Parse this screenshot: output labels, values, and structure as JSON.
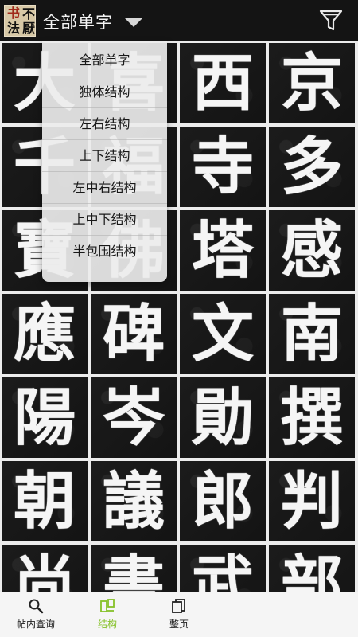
{
  "app": {
    "logo_chars": [
      "书",
      "不",
      "法",
      "厭"
    ],
    "title": "全部单字"
  },
  "dropdown": {
    "options": [
      "全部单字",
      "独体结构",
      "左右结构",
      "上下结构",
      "左中右结构",
      "上中下结构",
      "半包围结构"
    ]
  },
  "grid": {
    "characters": [
      "大",
      "喜",
      "西",
      "京",
      "千",
      "福",
      "寺",
      "多",
      "寶",
      "佛",
      "塔",
      "感",
      "應",
      "碑",
      "文",
      "南",
      "陽",
      "岑",
      "勛",
      "撰",
      "朝",
      "議",
      "郎",
      "判",
      "尚",
      "書",
      "武",
      "部"
    ]
  },
  "tabs": [
    {
      "label": "帖内查询",
      "icon": "search-icon"
    },
    {
      "label": "结构",
      "icon": "structure-icon"
    },
    {
      "label": "整页",
      "icon": "pages-icon"
    }
  ],
  "colors": {
    "accent": "#86c129",
    "topbar": "#141414",
    "tile": "#171717"
  }
}
